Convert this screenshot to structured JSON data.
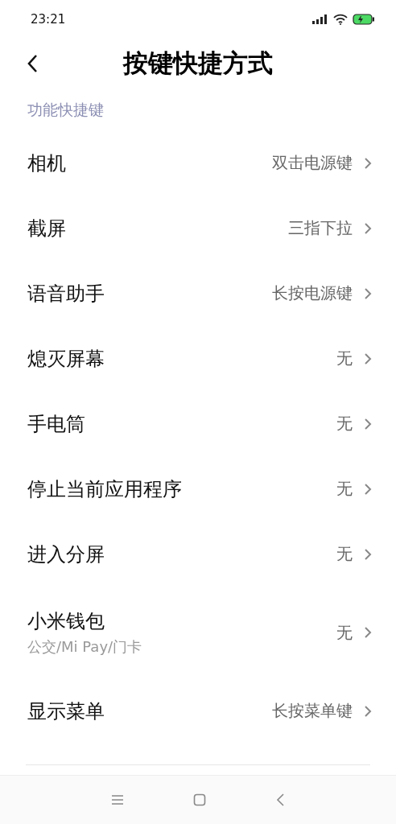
{
  "status_bar": {
    "time": "23:21"
  },
  "header": {
    "title": "按键快捷方式"
  },
  "section": {
    "title": "功能快捷键"
  },
  "items": [
    {
      "label": "相机",
      "value": "双击电源键"
    },
    {
      "label": "截屏",
      "value": "三指下拉"
    },
    {
      "label": "语音助手",
      "value": "长按电源键"
    },
    {
      "label": "熄灭屏幕",
      "value": "无"
    },
    {
      "label": "手电筒",
      "value": "无"
    },
    {
      "label": "停止当前应用程序",
      "value": "无"
    },
    {
      "label": "进入分屏",
      "value": "无"
    },
    {
      "label": "小米钱包",
      "subtitle": "公交/Mi Pay/门卡",
      "value": "无"
    },
    {
      "label": "显示菜单",
      "value": "长按菜单键"
    }
  ]
}
